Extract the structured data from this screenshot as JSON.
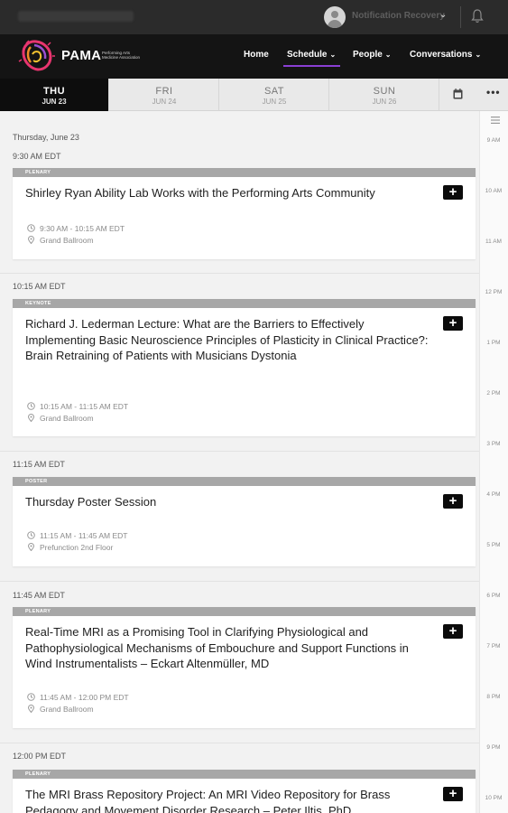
{
  "topbar": {
    "account_name": "Notification Recovery",
    "icons": [
      "avatar",
      "chevron-down-icon",
      "bell-icon"
    ]
  },
  "nav": {
    "brand": "PAMA",
    "brand_sub": "Performing Arts Medicine Association",
    "items": [
      {
        "label": "Home",
        "chevron": ""
      },
      {
        "label": "Schedule",
        "chevron": "⌄"
      },
      {
        "label": "People",
        "chevron": "⌄"
      },
      {
        "label": "Conversations",
        "chevron": "⌄"
      }
    ],
    "accent": "#8a3fd4"
  },
  "days": [
    {
      "name": "THU",
      "date": "JUN 23",
      "active": true
    },
    {
      "name": "FRI",
      "date": "JUN 24",
      "active": false
    },
    {
      "name": "SAT",
      "date": "JUN 25",
      "active": false
    },
    {
      "name": "SUN",
      "date": "JUN 26",
      "active": false
    }
  ],
  "schedule": {
    "date_heading": "Thursday, June 23",
    "slots": [
      {
        "time": "9:30 AM EDT",
        "sessions": [
          {
            "track": "PLENARY",
            "title": "Shirley Ryan Ability Lab Works with the Performing Arts Community",
            "time_range": "9:30 AM - 10:15 AM EDT",
            "location": "Grand Ballroom"
          }
        ]
      },
      {
        "time": "10:15 AM EDT",
        "sessions": [
          {
            "track": "KEYNOTE",
            "title": "Richard J. Lederman Lecture: What are the Barriers to Effectively Implementing Basic Neuroscience Principles of Plasticity in Clinical Practice?: Brain Retraining of Patients with Musicians Dystonia",
            "time_range": "10:15 AM - 11:15 AM EDT",
            "location": "Grand Ballroom"
          }
        ]
      },
      {
        "time": "11:15 AM EDT",
        "sessions": [
          {
            "track": "POSTER",
            "title": "Thursday Poster Session",
            "time_range": "11:15 AM - 11:45 AM EDT",
            "location": "Prefunction 2nd Floor"
          }
        ]
      },
      {
        "time": "11:45 AM EDT",
        "sessions": [
          {
            "track": "PLENARY",
            "title": "Real-Time MRI as a Promising Tool in Clarifying Physiological and Pathophysiological Mechanisms of Embouchure and Support Functions in Wind Instrumentalists – Eckart Altenmüller, MD",
            "time_range": "11:45 AM - 12:00 PM EDT",
            "location": "Grand Ballroom"
          }
        ]
      },
      {
        "time": "12:00 PM EDT",
        "sessions": [
          {
            "track": "PLENARY",
            "title": "The MRI Brass Repository Project: An MRI Video Repository for Brass Pedagogy and Movement Disorder Research – Peter Iltis, PhD",
            "time_range": "",
            "location": ""
          }
        ]
      }
    ]
  },
  "timeline": {
    "ticks": [
      "9 AM",
      "10 AM",
      "11 AM",
      "12 PM",
      "1 PM",
      "2 PM",
      "3 PM",
      "4 PM",
      "5 PM",
      "6 PM",
      "7 PM",
      "8 PM",
      "9 PM",
      "10 PM"
    ]
  }
}
